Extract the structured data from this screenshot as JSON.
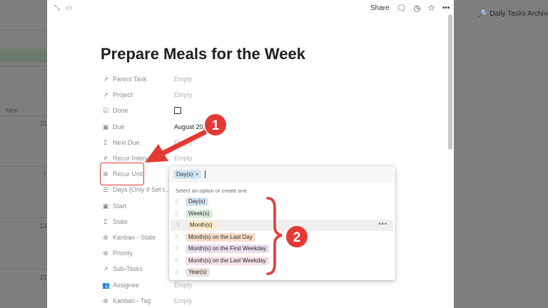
{
  "background": {
    "archive_label": "Daily Tasks Archive",
    "day_header": "Mon",
    "dates": [
      "31",
      "7",
      "14",
      "21"
    ]
  },
  "topbar": {
    "share_label": "Share"
  },
  "page": {
    "title": "Prepare Meals for the Week"
  },
  "properties": [
    {
      "icon": "↗",
      "icon_name": "relation-arrow-icon",
      "label": "Parent Task",
      "value": "Empty",
      "empty": true
    },
    {
      "icon": "↗",
      "icon_name": "relation-arrow-icon",
      "label": "Project",
      "value": "Empty",
      "empty": true
    },
    {
      "icon": "☑",
      "icon_name": "checkbox-property-icon",
      "label": "Done",
      "value": "",
      "empty": false
    },
    {
      "icon": "▣",
      "icon_name": "calendar-icon",
      "label": "Due",
      "value": "August 20, 2",
      "empty": false
    },
    {
      "icon": "Σ",
      "icon_name": "formula-icon",
      "label": "Next Due",
      "value": "Empty",
      "empty": true
    },
    {
      "icon": "#",
      "icon_name": "number-icon",
      "label": "Recur Interval",
      "value": "Empty",
      "empty": true
    },
    {
      "icon": "⊕",
      "icon_name": "select-icon",
      "label": "Recur Unit",
      "value": "",
      "empty": false
    },
    {
      "icon": "☰",
      "icon_name": "multiselect-icon",
      "label": "Days (Only if Set t...",
      "value": "",
      "empty": false
    },
    {
      "icon": "▣",
      "icon_name": "calendar-icon",
      "label": "Start",
      "value": "",
      "empty": false
    },
    {
      "icon": "Σ",
      "icon_name": "formula-icon",
      "label": "State",
      "value": "",
      "empty": false
    },
    {
      "icon": "⊕",
      "icon_name": "select-icon",
      "label": "Kanban - State",
      "value": "",
      "empty": false
    },
    {
      "icon": "⊕",
      "icon_name": "select-icon",
      "label": "Priority",
      "value": "",
      "empty": false
    },
    {
      "icon": "↗",
      "icon_name": "relation-arrow-icon",
      "label": "Sub-Tasks",
      "value": "",
      "empty": false
    },
    {
      "icon": "👥",
      "icon_name": "people-icon",
      "label": "Assignee",
      "value": "Empty",
      "empty": true
    },
    {
      "icon": "⊕",
      "icon_name": "select-icon",
      "label": "Kanban - Tag",
      "value": "Empty",
      "empty": true
    }
  ],
  "dropdown": {
    "selected_chip": "Day(s)",
    "chip_remove": "×",
    "hint": "Select an option or create one",
    "more_icon": "•••",
    "options": [
      {
        "label": "Day(s)",
        "color": "#d3e5ef"
      },
      {
        "label": "Week(s)",
        "color": "#dbeddb"
      },
      {
        "label": "Month(s)",
        "color": "#fdecc8"
      },
      {
        "label": "Month(s) on the Last Day",
        "color": "#fadec9"
      },
      {
        "label": "Month(s) on the First Weekday",
        "color": "#e8deee"
      },
      {
        "label": "Month(s) on the Last Weekday",
        "color": "#f5e0e9"
      },
      {
        "label": "Year(s)",
        "color": "#eee0da"
      }
    ]
  },
  "annotations": {
    "step1": "1",
    "step2": "2",
    "accent_color": "#e53935"
  }
}
